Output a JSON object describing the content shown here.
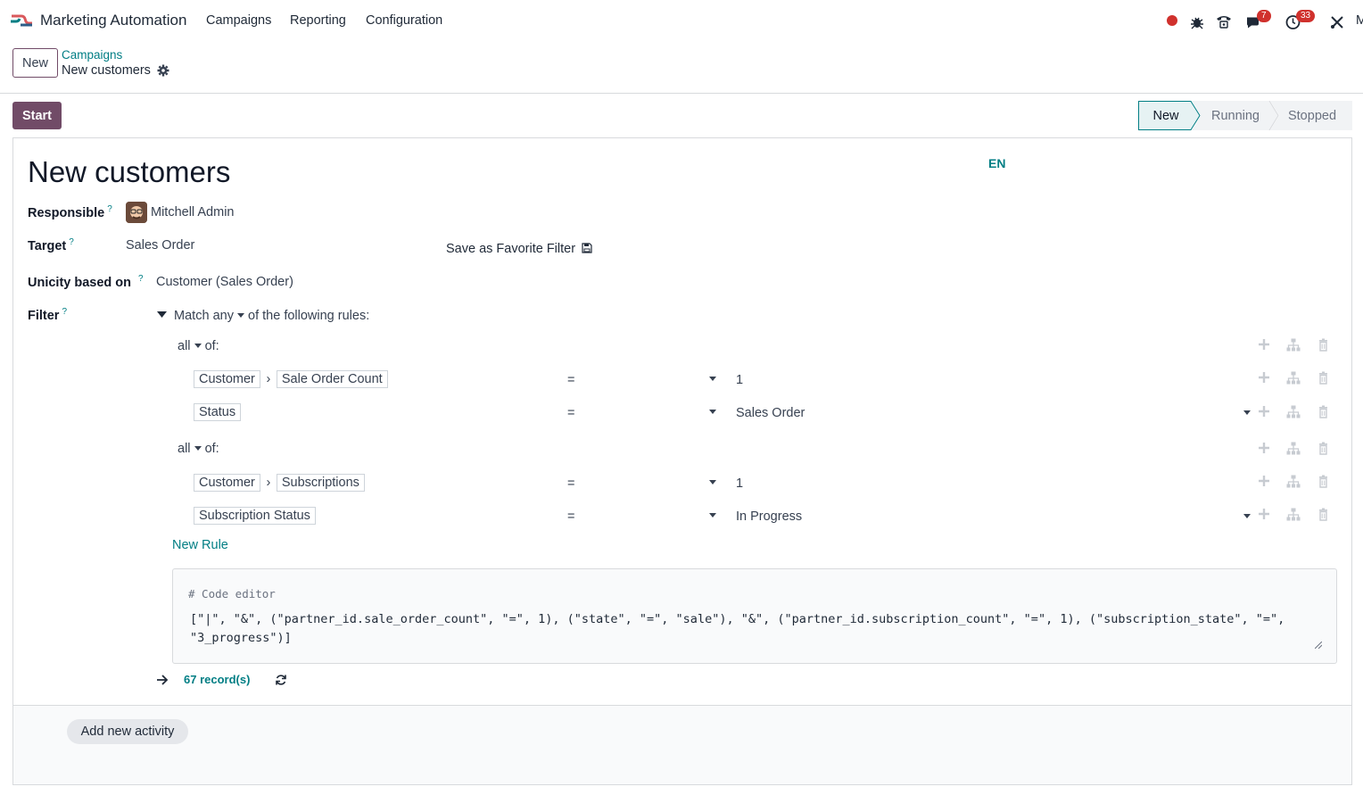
{
  "navbar": {
    "app_title": "Marketing Automation",
    "menus": [
      "Campaigns",
      "Reporting",
      "Configuration"
    ],
    "tray": {
      "messages_count": "7",
      "activities_count": "33",
      "user_initial": "M"
    }
  },
  "control_panel": {
    "new_label": "New",
    "breadcrumb_parent": "Campaigns",
    "breadcrumb_current": "New customers"
  },
  "statusbar": {
    "start_label": "Start",
    "stages": [
      "New",
      "Running",
      "Stopped"
    ],
    "active_stage": "New"
  },
  "form": {
    "title": "New customers",
    "lang": "EN",
    "responsible_label": "Responsible",
    "responsible_value": "Mitchell Admin",
    "target_label": "Target",
    "target_value": "Sales Order",
    "save_favorite_label": "Save as Favorite Filter",
    "unicity_label": "Unicity based on",
    "unicity_value": "Customer (Sales Order)",
    "filter_label": "Filter",
    "help_mark": "?"
  },
  "domain": {
    "match_prefix": "Match",
    "match_mode": "any",
    "match_suffix": "of the following rules:",
    "groups": [
      {
        "mode": "all",
        "suffix": "of:",
        "rules": [
          {
            "path": [
              "Customer",
              "Sale Order Count"
            ],
            "operator": "=",
            "value": "1"
          },
          {
            "path": [
              "Status"
            ],
            "operator": "=",
            "value": "Sales Order"
          }
        ]
      },
      {
        "mode": "all",
        "suffix": "of:",
        "rules": [
          {
            "path": [
              "Customer",
              "Subscriptions"
            ],
            "operator": "=",
            "value": "1"
          },
          {
            "path": [
              "Subscription Status"
            ],
            "operator": "=",
            "value": "In Progress"
          }
        ]
      }
    ],
    "new_rule_label": "New Rule",
    "code_comment": "# Code editor",
    "code": "[\"|\", \"&\", (\"partner_id.sale_order_count\", \"=\", 1), (\"state\", \"=\", \"sale\"), \"&\", (\"partner_id.subscription_count\", \"=\", 1), (\"subscription_state\", \"=\", \"3_progress\")]",
    "records_label": "67 record(s)"
  },
  "activities": {
    "add_label": "Add new activity"
  },
  "colors": {
    "brand": "#714b67",
    "link": "#017e84",
    "badge": "#d0312d"
  }
}
